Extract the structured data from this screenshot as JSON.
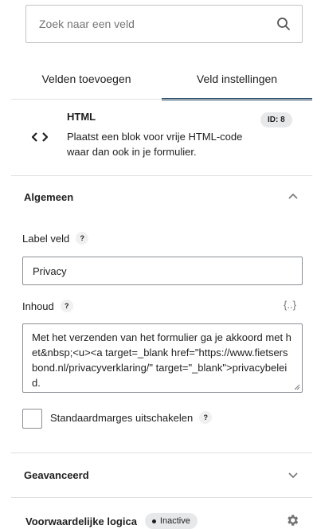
{
  "search": {
    "placeholder": "Zoek naar een veld",
    "value": ""
  },
  "tabs": [
    {
      "label": "Velden toevoegen"
    },
    {
      "label": "Veld instellingen"
    }
  ],
  "field": {
    "title": "HTML",
    "description": "Plaatst een blok voor vrije HTML-code waar dan ook in je formulier.",
    "id_badge": "ID: 8",
    "icon": "code-icon"
  },
  "general": {
    "title": "Algemeen",
    "label_field": {
      "label": "Label veld",
      "help": "?",
      "value": "Privacy"
    },
    "content": {
      "label": "Inhoud",
      "help": "?",
      "merge_tag": "{..}",
      "value": "Met het verzenden van het formulier ga je akkoord met het&nbsp;<u><a target=_blank href=\"https://www.fietsersbond.nl/privacyverklaring/\" target=\"_blank\">privacybeleid."
    },
    "disable_margins": {
      "label": "Standaardmarges uitschakelen",
      "help": "?",
      "checked": false
    }
  },
  "advanced": {
    "title": "Geavanceerd"
  },
  "conditional_logic": {
    "title": "Voorwaardelijke logica",
    "status": "Inactive"
  },
  "colors": {
    "accent": "#1b3f5e",
    "border": "#8c8f94",
    "badge_bg": "#e6e8ea"
  }
}
